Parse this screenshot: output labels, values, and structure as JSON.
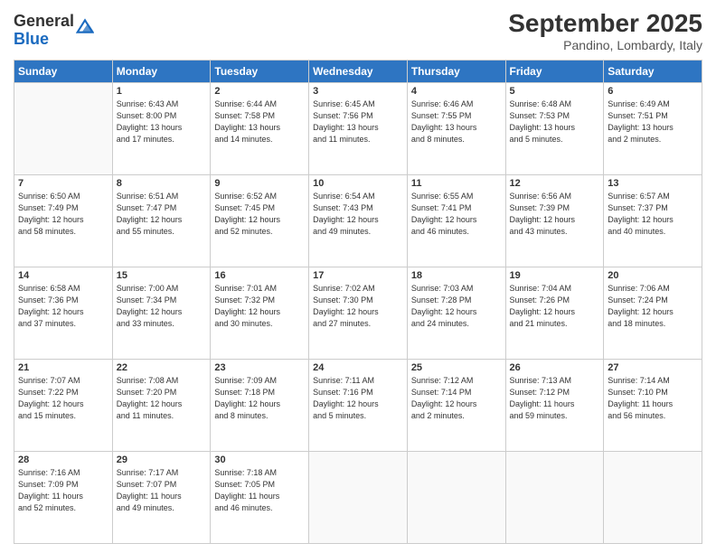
{
  "logo": {
    "general": "General",
    "blue": "Blue"
  },
  "title": "September 2025",
  "location": "Pandino, Lombardy, Italy",
  "weekdays": [
    "Sunday",
    "Monday",
    "Tuesday",
    "Wednesday",
    "Thursday",
    "Friday",
    "Saturday"
  ],
  "weeks": [
    [
      {
        "day": "",
        "info": ""
      },
      {
        "day": "1",
        "info": "Sunrise: 6:43 AM\nSunset: 8:00 PM\nDaylight: 13 hours\nand 17 minutes."
      },
      {
        "day": "2",
        "info": "Sunrise: 6:44 AM\nSunset: 7:58 PM\nDaylight: 13 hours\nand 14 minutes."
      },
      {
        "day": "3",
        "info": "Sunrise: 6:45 AM\nSunset: 7:56 PM\nDaylight: 13 hours\nand 11 minutes."
      },
      {
        "day": "4",
        "info": "Sunrise: 6:46 AM\nSunset: 7:55 PM\nDaylight: 13 hours\nand 8 minutes."
      },
      {
        "day": "5",
        "info": "Sunrise: 6:48 AM\nSunset: 7:53 PM\nDaylight: 13 hours\nand 5 minutes."
      },
      {
        "day": "6",
        "info": "Sunrise: 6:49 AM\nSunset: 7:51 PM\nDaylight: 13 hours\nand 2 minutes."
      }
    ],
    [
      {
        "day": "7",
        "info": "Sunrise: 6:50 AM\nSunset: 7:49 PM\nDaylight: 12 hours\nand 58 minutes."
      },
      {
        "day": "8",
        "info": "Sunrise: 6:51 AM\nSunset: 7:47 PM\nDaylight: 12 hours\nand 55 minutes."
      },
      {
        "day": "9",
        "info": "Sunrise: 6:52 AM\nSunset: 7:45 PM\nDaylight: 12 hours\nand 52 minutes."
      },
      {
        "day": "10",
        "info": "Sunrise: 6:54 AM\nSunset: 7:43 PM\nDaylight: 12 hours\nand 49 minutes."
      },
      {
        "day": "11",
        "info": "Sunrise: 6:55 AM\nSunset: 7:41 PM\nDaylight: 12 hours\nand 46 minutes."
      },
      {
        "day": "12",
        "info": "Sunrise: 6:56 AM\nSunset: 7:39 PM\nDaylight: 12 hours\nand 43 minutes."
      },
      {
        "day": "13",
        "info": "Sunrise: 6:57 AM\nSunset: 7:37 PM\nDaylight: 12 hours\nand 40 minutes."
      }
    ],
    [
      {
        "day": "14",
        "info": "Sunrise: 6:58 AM\nSunset: 7:36 PM\nDaylight: 12 hours\nand 37 minutes."
      },
      {
        "day": "15",
        "info": "Sunrise: 7:00 AM\nSunset: 7:34 PM\nDaylight: 12 hours\nand 33 minutes."
      },
      {
        "day": "16",
        "info": "Sunrise: 7:01 AM\nSunset: 7:32 PM\nDaylight: 12 hours\nand 30 minutes."
      },
      {
        "day": "17",
        "info": "Sunrise: 7:02 AM\nSunset: 7:30 PM\nDaylight: 12 hours\nand 27 minutes."
      },
      {
        "day": "18",
        "info": "Sunrise: 7:03 AM\nSunset: 7:28 PM\nDaylight: 12 hours\nand 24 minutes."
      },
      {
        "day": "19",
        "info": "Sunrise: 7:04 AM\nSunset: 7:26 PM\nDaylight: 12 hours\nand 21 minutes."
      },
      {
        "day": "20",
        "info": "Sunrise: 7:06 AM\nSunset: 7:24 PM\nDaylight: 12 hours\nand 18 minutes."
      }
    ],
    [
      {
        "day": "21",
        "info": "Sunrise: 7:07 AM\nSunset: 7:22 PM\nDaylight: 12 hours\nand 15 minutes."
      },
      {
        "day": "22",
        "info": "Sunrise: 7:08 AM\nSunset: 7:20 PM\nDaylight: 12 hours\nand 11 minutes."
      },
      {
        "day": "23",
        "info": "Sunrise: 7:09 AM\nSunset: 7:18 PM\nDaylight: 12 hours\nand 8 minutes."
      },
      {
        "day": "24",
        "info": "Sunrise: 7:11 AM\nSunset: 7:16 PM\nDaylight: 12 hours\nand 5 minutes."
      },
      {
        "day": "25",
        "info": "Sunrise: 7:12 AM\nSunset: 7:14 PM\nDaylight: 12 hours\nand 2 minutes."
      },
      {
        "day": "26",
        "info": "Sunrise: 7:13 AM\nSunset: 7:12 PM\nDaylight: 11 hours\nand 59 minutes."
      },
      {
        "day": "27",
        "info": "Sunrise: 7:14 AM\nSunset: 7:10 PM\nDaylight: 11 hours\nand 56 minutes."
      }
    ],
    [
      {
        "day": "28",
        "info": "Sunrise: 7:16 AM\nSunset: 7:09 PM\nDaylight: 11 hours\nand 52 minutes."
      },
      {
        "day": "29",
        "info": "Sunrise: 7:17 AM\nSunset: 7:07 PM\nDaylight: 11 hours\nand 49 minutes."
      },
      {
        "day": "30",
        "info": "Sunrise: 7:18 AM\nSunset: 7:05 PM\nDaylight: 11 hours\nand 46 minutes."
      },
      {
        "day": "",
        "info": ""
      },
      {
        "day": "",
        "info": ""
      },
      {
        "day": "",
        "info": ""
      },
      {
        "day": "",
        "info": ""
      }
    ]
  ]
}
